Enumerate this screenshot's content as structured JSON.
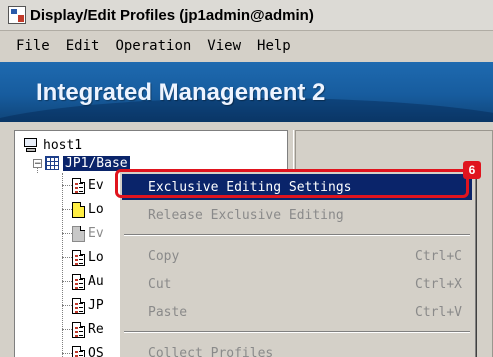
{
  "window": {
    "title": "Display/Edit Profiles (jp1admin@admin)",
    "icon": "profile-app-icon"
  },
  "menubar": {
    "items": [
      "File",
      "Edit",
      "Operation",
      "View",
      "Help"
    ]
  },
  "banner": {
    "title": "Integrated Management 2"
  },
  "tree": {
    "host": "host1",
    "expander": "−",
    "selected_node": "JP1/Base",
    "children": [
      {
        "label": "Ev",
        "icon": "doc-icon",
        "state": "normal"
      },
      {
        "label": "Lo",
        "icon": "yellow-doc-icon",
        "state": "normal"
      },
      {
        "label": "Ev",
        "icon": "gray-doc-icon",
        "state": "disabled"
      },
      {
        "label": "Lo",
        "icon": "doc-icon",
        "state": "normal"
      },
      {
        "label": "Au",
        "icon": "doc-icon",
        "state": "normal"
      },
      {
        "label": "JP",
        "icon": "doc-icon",
        "state": "normal"
      },
      {
        "label": "Re",
        "icon": "doc-icon",
        "state": "normal"
      },
      {
        "label": "OS",
        "icon": "doc-icon",
        "state": "normal"
      }
    ]
  },
  "context_menu": {
    "items": [
      {
        "label": "Exclusive Editing Settings",
        "shortcut": "",
        "state": "highlighted"
      },
      {
        "label": "Release Exclusive Editing",
        "shortcut": "",
        "state": "disabled"
      },
      {
        "label": "Copy",
        "shortcut": "Ctrl+C",
        "state": "disabled"
      },
      {
        "label": "Cut",
        "shortcut": "Ctrl+X",
        "state": "disabled"
      },
      {
        "label": "Paste",
        "shortcut": "Ctrl+V",
        "state": "disabled"
      },
      {
        "label": "Collect Profiles",
        "shortcut": "",
        "state": "disabled"
      }
    ]
  },
  "callout": {
    "number": "6",
    "color": "#e0141e"
  },
  "colors": {
    "banner": "#175c9e",
    "selection": "#0a246a",
    "menu_bg": "#d4d0c8"
  }
}
